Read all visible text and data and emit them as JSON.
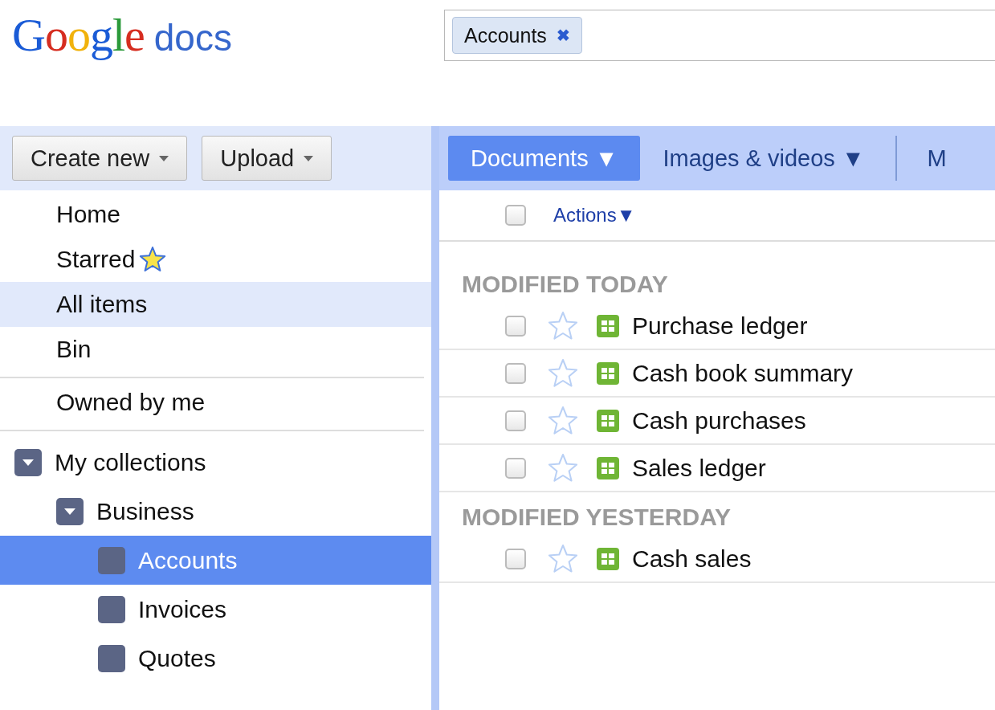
{
  "logo": {
    "brand": "Google",
    "product": "docs"
  },
  "search": {
    "chips": [
      {
        "label": "Accounts",
        "remove": "✖"
      }
    ]
  },
  "toolbar": {
    "buttons": [
      {
        "label": "Create new"
      },
      {
        "label": "Upload"
      }
    ]
  },
  "tabs": [
    {
      "label": "Documents ▼",
      "selected": true
    },
    {
      "label": "Images & videos ▼",
      "selected": false
    },
    {
      "label": "M",
      "selected": false
    }
  ],
  "sidebar": {
    "groups": [
      {
        "items": [
          {
            "label": "Home",
            "selected": false
          },
          {
            "label": "Starred",
            "selected": false,
            "star": true
          },
          {
            "label": "All items",
            "selected": true
          },
          {
            "label": "Bin",
            "selected": false
          }
        ]
      },
      {
        "items": [
          {
            "label": "Owned by me",
            "selected": false
          }
        ]
      }
    ],
    "collections": [
      {
        "label": "My collections",
        "expanded": true,
        "selected": false,
        "children": [
          {
            "label": "Business",
            "expanded": true,
            "selected": false,
            "children": [
              {
                "label": "Accounts",
                "selected": true
              },
              {
                "label": "Invoices",
                "selected": false
              },
              {
                "label": "Quotes",
                "selected": false
              }
            ]
          }
        ]
      }
    ]
  },
  "list": {
    "select_all": {
      "checked": false
    },
    "actions": "Actions▼",
    "groups": [
      {
        "heading": "MODIFIED TODAY",
        "docs": [
          {
            "title": "Purchase ledger",
            "checked": false,
            "starred": false
          },
          {
            "title": "Cash book summary",
            "checked": false,
            "starred": false
          },
          {
            "title": "Cash purchases",
            "checked": false,
            "starred": false
          },
          {
            "title": "Sales ledger",
            "checked": false,
            "starred": false
          }
        ]
      },
      {
        "heading": "MODIFIED YESTERDAY",
        "docs": [
          {
            "title": "Cash sales",
            "checked": false,
            "starred": false
          }
        ]
      }
    ]
  }
}
